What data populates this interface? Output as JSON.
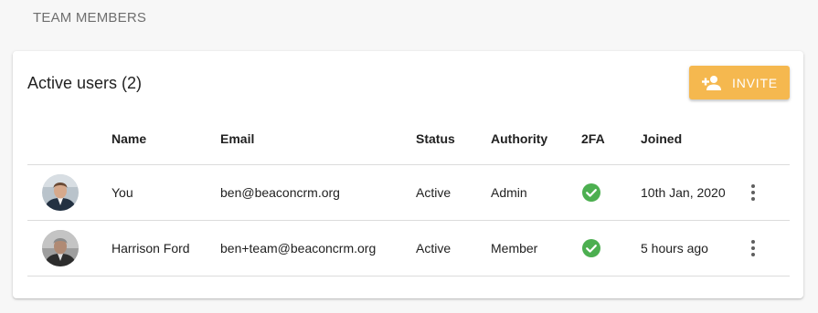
{
  "page": {
    "section_title": "TEAM MEMBERS"
  },
  "card": {
    "title": "Active users (2)",
    "invite_label": "INVITE",
    "invite_icon": "person-add-icon",
    "accent_color": "#f5b84f"
  },
  "table": {
    "headers": {
      "name": "Name",
      "email": "Email",
      "status": "Status",
      "authority": "Authority",
      "twofa": "2FA",
      "joined": "Joined"
    },
    "rows": [
      {
        "avatar": "user-avatar",
        "name": "You",
        "email": "ben@beaconcrm.org",
        "status": "Active",
        "authority": "Admin",
        "twofa_icon": "check-circle-icon",
        "twofa_color": "#4caf50",
        "joined": "10th Jan, 2020"
      },
      {
        "avatar": "user-avatar",
        "name": "Harrison Ford",
        "email": "ben+team@beaconcrm.org",
        "status": "Active",
        "authority": "Member",
        "twofa_icon": "check-circle-icon",
        "twofa_color": "#4caf50",
        "joined": "5 hours ago"
      }
    ]
  }
}
